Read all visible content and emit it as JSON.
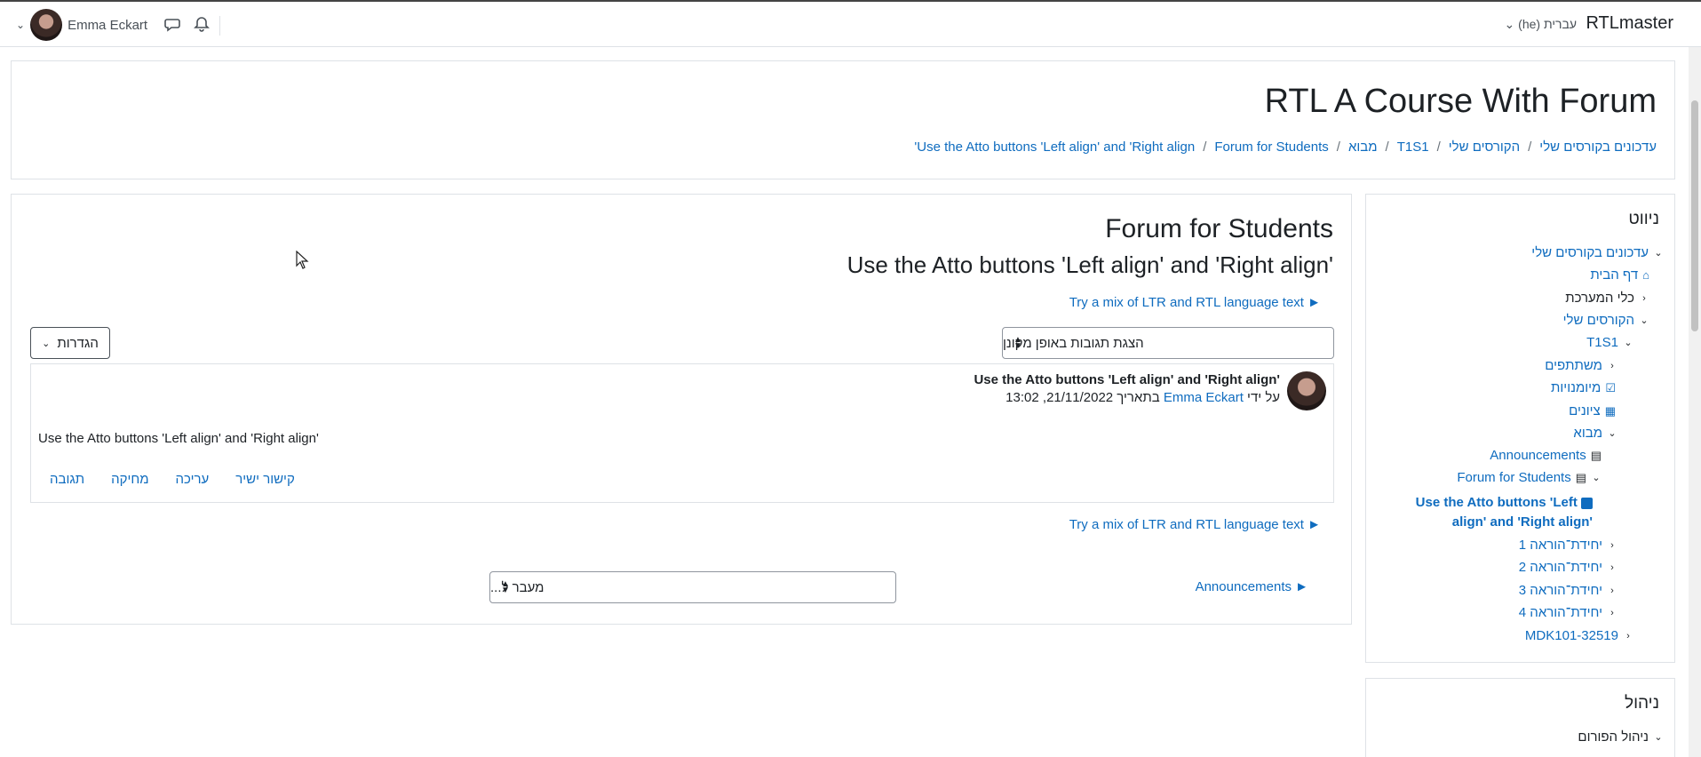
{
  "topbar": {
    "brand": "RTLmaster",
    "language": "עברית ‎(he)‎",
    "user_name": "Emma Eckart"
  },
  "header": {
    "course_title": "RTL A Course With Forum",
    "breadcrumb": [
      "עדכונים בקורסים שלי",
      "הקורסים שלי",
      "T1S1",
      "מבוא",
      "Forum for Students",
      "Use the Atto buttons 'Left align' and 'Right align'"
    ]
  },
  "main": {
    "forum_title": "Forum for Students",
    "discussion_title": "Use the Atto buttons 'Left align' and 'Right align'",
    "mix_link": "Try a mix of LTR and RTL language text ►",
    "display_mode": "הצגת תגובות באופן מקונן",
    "settings_label": "הגדרות",
    "post": {
      "subject": "Use the Atto buttons 'Left align' and 'Right align'",
      "meta_by": "על ידי",
      "meta_author": "Emma Eckart",
      "meta_date": "בתאריך 21/11/2022, 13:02",
      "body": "Use the Atto buttons 'Left align' and 'Right align'",
      "actions": [
        "תגובה",
        "מחיקה",
        "עריכה",
        "קישור ישיר"
      ]
    },
    "prev_activity": "Announcements ►",
    "jump_to": "מעבר ל..."
  },
  "navigation": {
    "title": "ניווט",
    "items": [
      {
        "label": "עדכונים בקורסים שלי"
      },
      {
        "label": "דף הבית"
      },
      {
        "label": "כלי המערכת"
      },
      {
        "label": "הקורסים שלי"
      },
      {
        "label": "T1S1"
      },
      {
        "label": "משתתפים"
      },
      {
        "label": "מיומנויות"
      },
      {
        "label": "ציונים"
      },
      {
        "label": "מבוא"
      },
      {
        "label": "Announcements"
      },
      {
        "label": "Forum for Students"
      },
      {
        "label_line1": "Use the Atto buttons 'Left",
        "label_line2": "align' and 'Right align'"
      },
      {
        "label": "יחידת־הוראה 1"
      },
      {
        "label": "יחידת־הוראה 2"
      },
      {
        "label": "יחידת־הוראה 3"
      },
      {
        "label": "יחידת־הוראה 4"
      },
      {
        "label": "MDK101-32519"
      }
    ]
  },
  "admin": {
    "title": "ניהול",
    "forum_admin": "ניהול הפורום"
  },
  "colors": {
    "link": "#0f6cbf",
    "text": "#1d2125",
    "border": "#dee2e6"
  }
}
